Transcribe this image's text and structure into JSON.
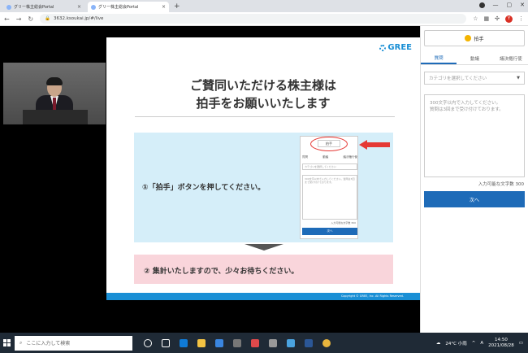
{
  "browser": {
    "tabs": [
      {
        "title": "グリー株主総会Portal",
        "close": "×"
      },
      {
        "title": "グリー株主総会Portal",
        "close": "×"
      }
    ],
    "new_tab": "+",
    "url": "3632.ksoukai.jp/#/live"
  },
  "slide": {
    "logo": "GREE",
    "title_line1": "ご賛同いただける株主様は",
    "title_line2": "拍手をお願いいたします",
    "step1": "①「拍手」ボタンを押してください。",
    "step2": "② 集計いたしますので、少々お待ちください。",
    "mock": {
      "clap_label": "拍手",
      "tabs": [
        "質問",
        "動議",
        "議決権行使"
      ],
      "category_placeholder": "カテゴリを選択してください",
      "textarea_placeholder": "300文字以内で入力してください。質問は3回まで受け付けております。",
      "remaining": "入力可能な文字数 300",
      "submit": "次へ"
    },
    "footer": "Copyright © GREE, Inc. All Rights Reserved."
  },
  "panel": {
    "clap_label": "拍手",
    "tabs": [
      "質問",
      "動議",
      "議決権行使"
    ],
    "active_tab": "質問",
    "category_placeholder": "カテゴリを選択してください",
    "question_placeholder": "300文字以内で入力してください。\n質問は3回まで受け付けております。",
    "remaining": "入力可能な文字数 300",
    "submit": "次へ"
  },
  "taskbar": {
    "search_placeholder": "ここに入力して検索",
    "weather": "24°C 小雨",
    "ime": "A",
    "time": "14:50",
    "date": "2021/08/28"
  },
  "colors": {
    "accent": "#1e6bb8",
    "slide_blue": "#1a8fd5",
    "step1_bg": "#d5eef9",
    "step2_bg": "#f9d5db",
    "arrow_red": "#e53935"
  }
}
